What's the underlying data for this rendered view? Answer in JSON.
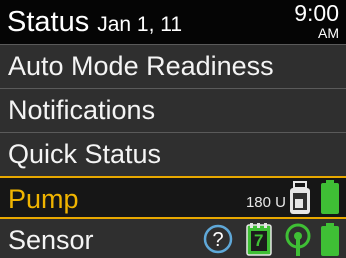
{
  "header": {
    "title": "Status",
    "date": "Jan 1, 11",
    "time": "9:00",
    "ampm": "AM"
  },
  "menu": {
    "items": [
      {
        "label": "Auto Mode Readiness"
      },
      {
        "label": "Notifications"
      },
      {
        "label": "Quick Status"
      },
      {
        "label": "Pump"
      },
      {
        "label": "Sensor"
      }
    ],
    "selected_index": 3
  },
  "pump_status": {
    "reservoir": "180 U",
    "icons": [
      "reservoir-icon",
      "battery-icon"
    ]
  },
  "sensor_status": {
    "calibration_days": "7",
    "icons": [
      "help-icon",
      "calendar-icon",
      "sensor-connection-icon",
      "battery-icon"
    ]
  },
  "colors": {
    "highlight": "#f0b400",
    "battery": "#3fbf35",
    "help": "#5fa8d8",
    "row_bg": "#2f2f2f"
  }
}
